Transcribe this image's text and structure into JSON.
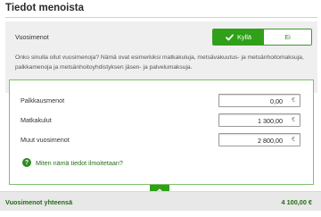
{
  "section": {
    "title": "Tiedot menoista"
  },
  "question": {
    "label": "Vuosimenot",
    "yes_label": "Kyllä",
    "no_label": "Ei",
    "selected": "Kyllä"
  },
  "help": {
    "text": "Onko sinulla ollut vuosimenoja? Nämä ovat esimerkiksi matkakuluja, metsävakuutus- ja metsänhoitomaksuja, palkkamenoja ja metsänhoitoyhdistyksen jäsen- ja palvelumaksuja."
  },
  "fields": [
    {
      "label": "Palkkausmenot",
      "value": "0,00",
      "currency": "€"
    },
    {
      "label": "Matkakulut",
      "value": "1 300,00",
      "currency": "€"
    },
    {
      "label": "Muut vuosimenot",
      "value": "2 800,00",
      "currency": "€"
    }
  ],
  "help_link": {
    "icon": "question-circle-icon",
    "text": "Miten nämä tiedot ilmoitetaan?"
  },
  "total": {
    "label": "Vuosimenot yhteensä",
    "value": "4 100,00 €"
  },
  "colors": {
    "accent_green": "#2fa017",
    "link_green": "#2a6f1c",
    "panel_border": "#7fbf6c"
  }
}
